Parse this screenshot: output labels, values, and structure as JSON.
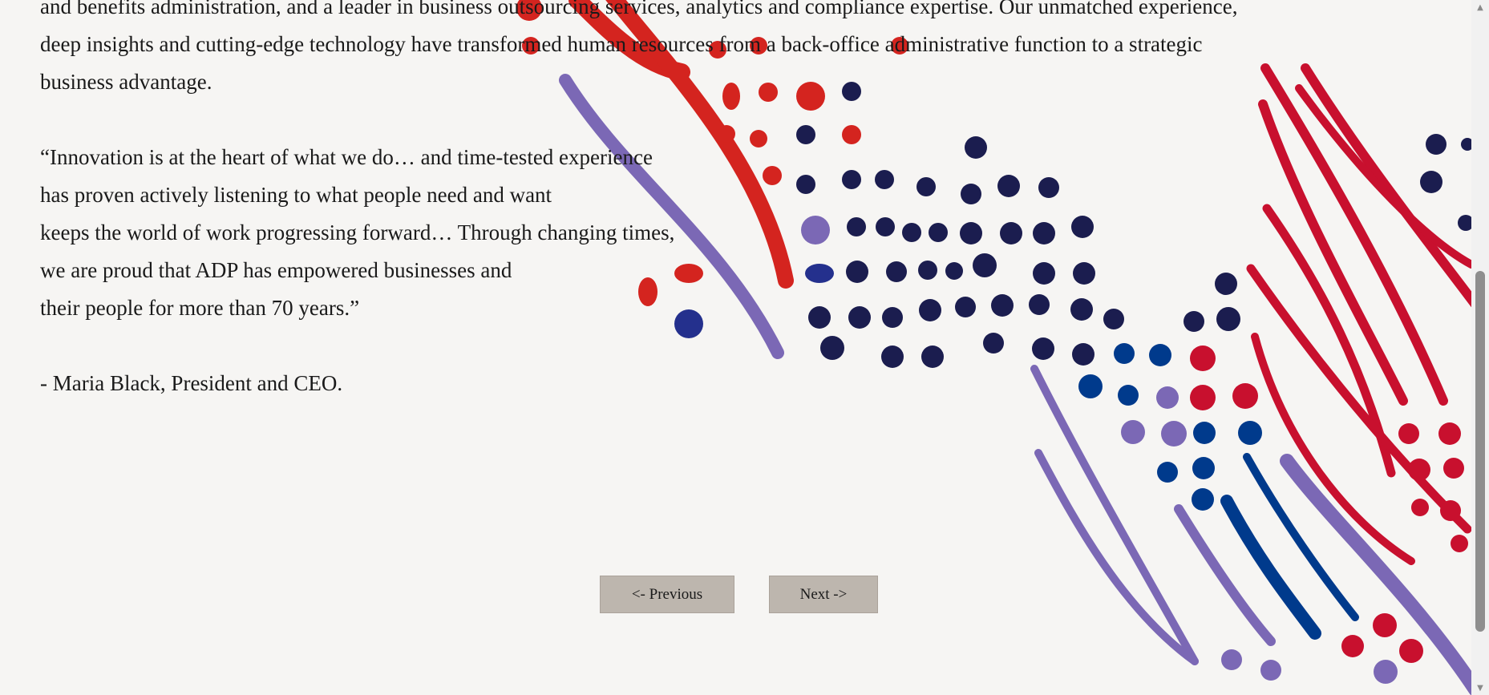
{
  "content": {
    "partial_line": "and benefits administration, and a leader in business outsourcing services, analytics and compliance expertise. Our unmatched experience,",
    "line_2": "deep insights and cutting-edge technology have transformed human resources from a back-office administrative function to a strategic",
    "line_3": "business advantage.",
    "quote": [
      "“Innovation is at the heart of what we do… and time-tested experience",
      "has proven actively listening to what people need and want",
      "keeps the world of work progressing forward… Through changing times,",
      "we are proud that ADP has empowered businesses and",
      "their people for more than 70 years.”"
    ],
    "attribution": "- Maria Black, President and CEO."
  },
  "navigation": {
    "previous_label": "<- Previous",
    "next_label": "Next ->"
  },
  "colors": {
    "background": "#f6f5f3",
    "red": "#d4241f",
    "crimson": "#c8102e",
    "navy": "#1b1d4f",
    "blue": "#003a8c",
    "purple": "#7b68b5",
    "button": "#bdb6ae"
  },
  "scrollbar": {
    "up_icon": "▲",
    "down_icon": "▼"
  }
}
